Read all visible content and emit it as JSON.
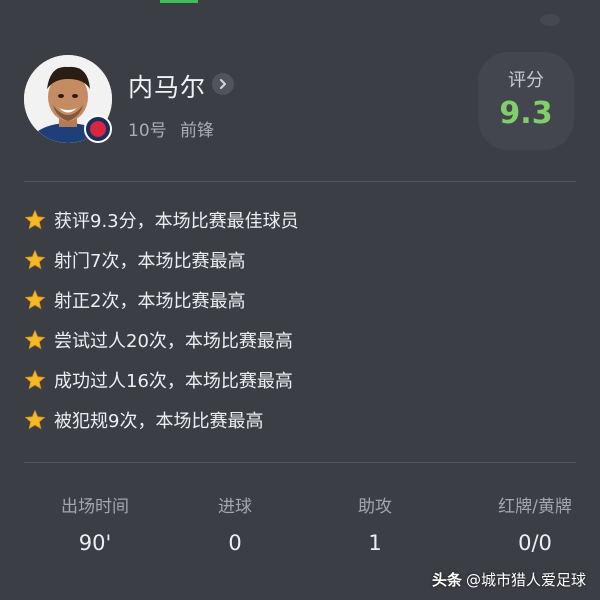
{
  "player": {
    "name": "内马尔",
    "number": "10号",
    "position": "前锋"
  },
  "rating": {
    "label": "评分",
    "value": "9.3",
    "color": "#7fd06a"
  },
  "highlights": [
    "获评9.3分，本场比赛最佳球员",
    "射门7次，本场比赛最高",
    "射正2次，本场比赛最高",
    "尝试过人20次，本场比赛最高",
    "成功过人16次，本场比赛最高",
    "被犯规9次，本场比赛最高"
  ],
  "stats": [
    {
      "label": "出场时间",
      "value": "90'"
    },
    {
      "label": "进球",
      "value": "0"
    },
    {
      "label": "助攻",
      "value": "1"
    },
    {
      "label": "红牌/黄牌",
      "value": "0/0"
    }
  ],
  "watermark": {
    "brand": "头条",
    "text": "@城市猎人爱足球"
  },
  "icons": {
    "star": "star-icon",
    "chevron": "chevron-right-icon",
    "club": "club-badge-icon"
  }
}
